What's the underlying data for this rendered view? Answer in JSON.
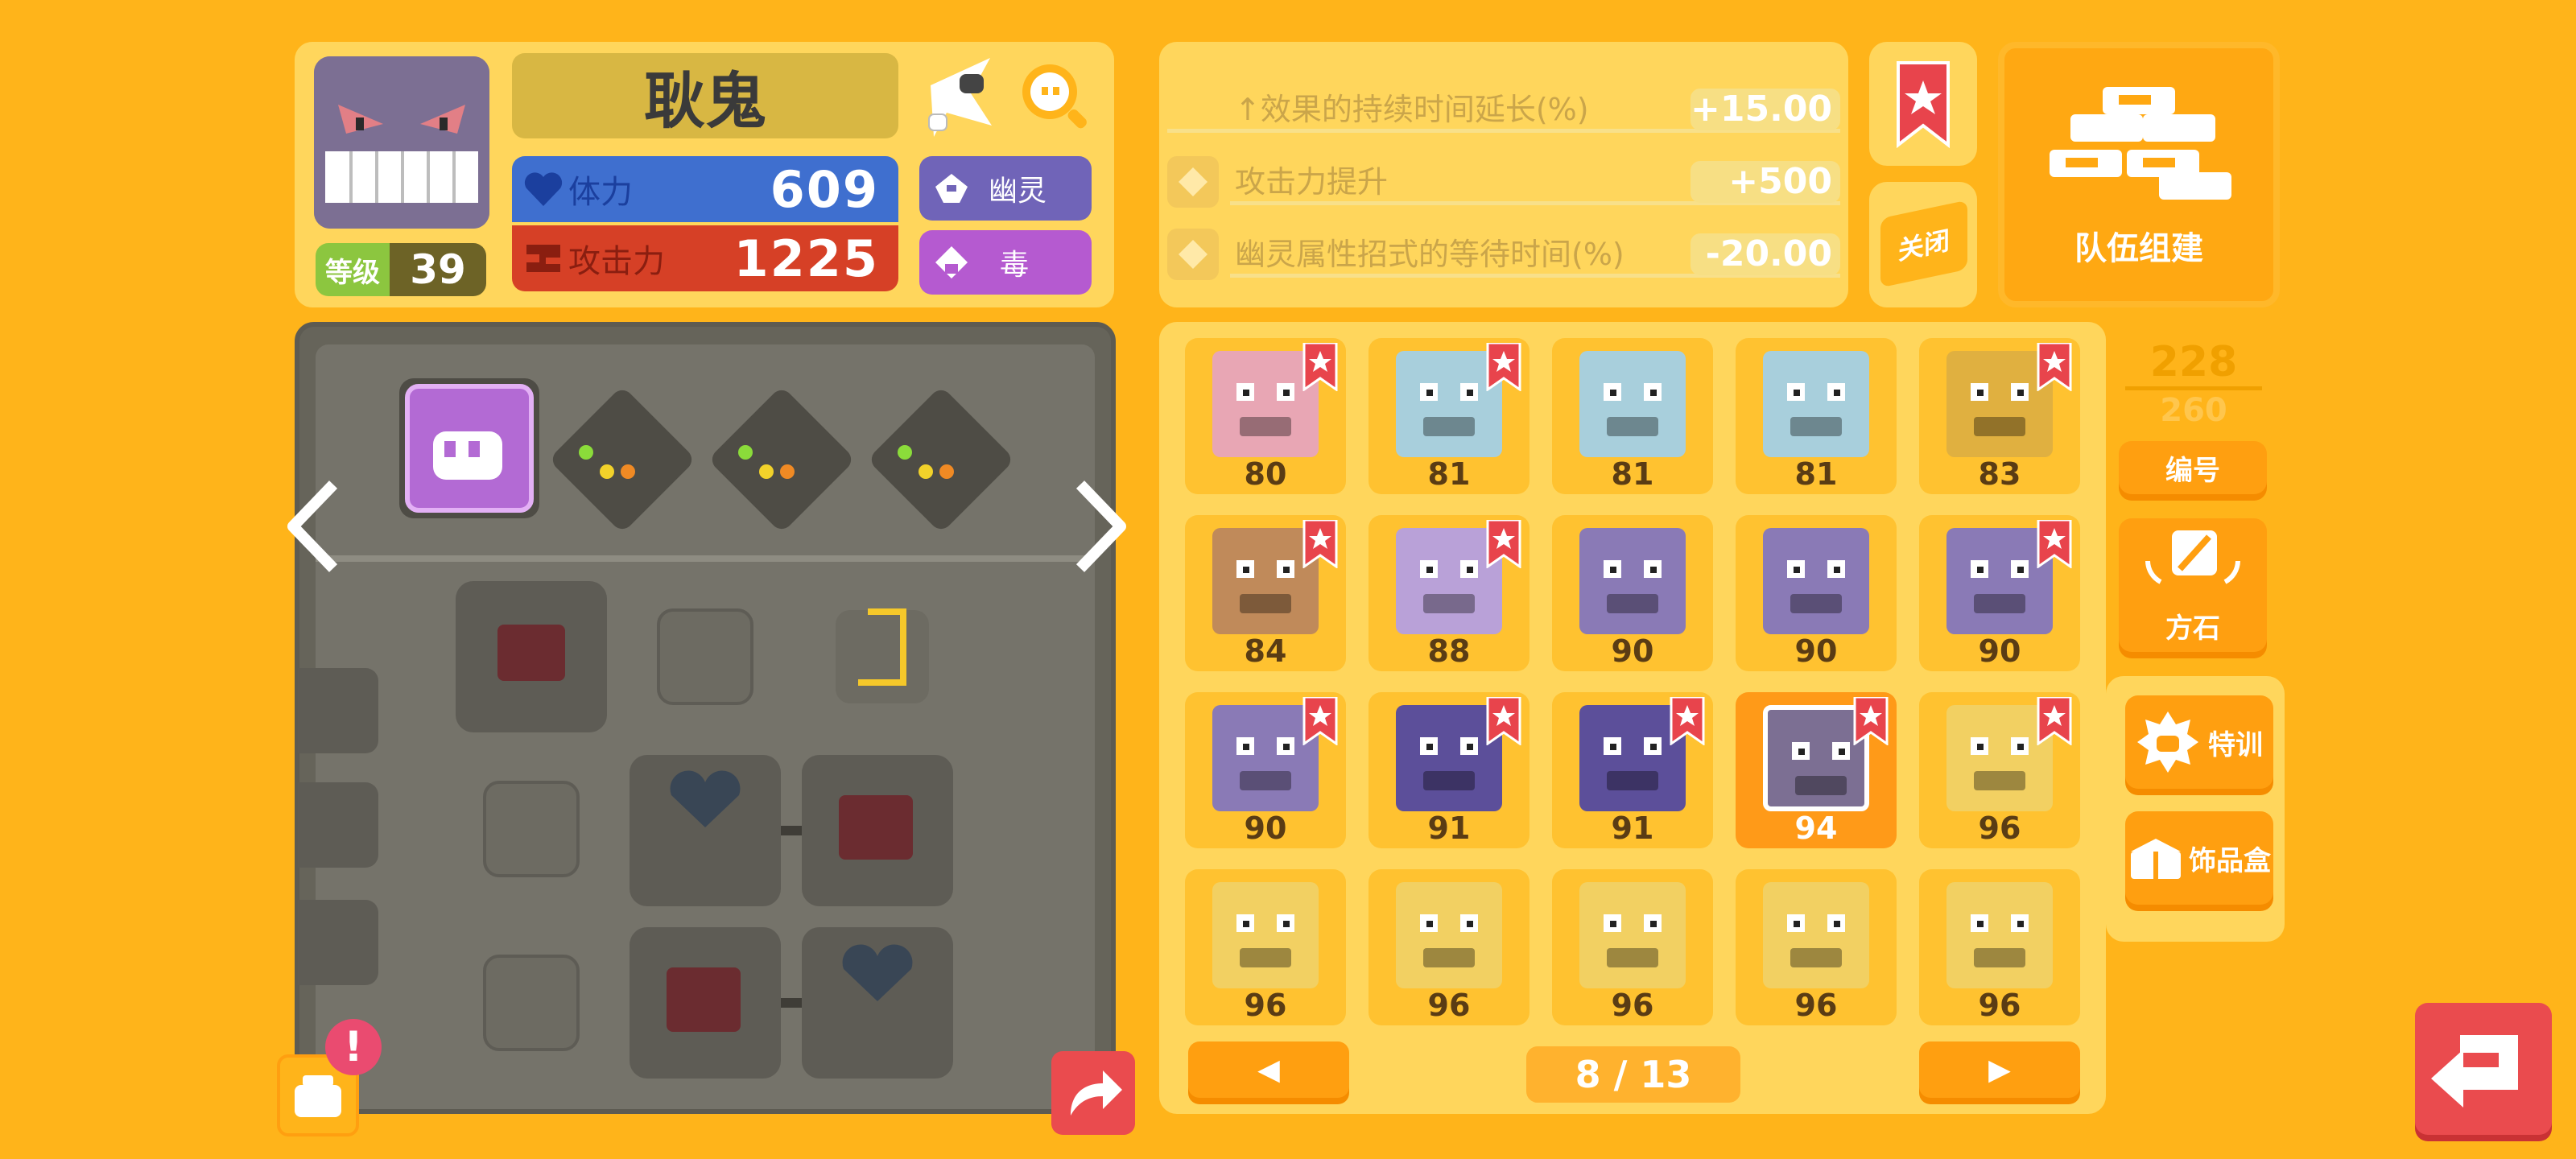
{
  "pokemon": {
    "name": "耿鬼",
    "level_label": "等级",
    "level": "39",
    "hp_label": "体力",
    "hp": "609",
    "attack_label": "攻击力",
    "attack": "1225",
    "types": [
      "幽灵",
      "毒"
    ]
  },
  "skills": [
    {
      "label": "↑效果的持续时间延长(%)",
      "value": "+15.00"
    },
    {
      "label": "攻击力提升",
      "value": "+500"
    },
    {
      "label": "幽灵属性招式的等待时间(%)",
      "value": "-20.00"
    }
  ],
  "close_label": "关闭",
  "team_label": "队伍组建",
  "box": {
    "count": "228",
    "capacity": "260",
    "number_label": "编号",
    "stones_label": "方石",
    "training_label": "特训",
    "accessory_label": "饰品盒",
    "page": "8 / 13",
    "prev_icon": "◀",
    "next_icon": "▶"
  },
  "grid": [
    {
      "level": "80",
      "color": "#e8a6b4",
      "bookmark": true
    },
    {
      "level": "81",
      "color": "#a8cfdc",
      "bookmark": true
    },
    {
      "level": "81",
      "color": "#a8cfdc",
      "bookmark": false
    },
    {
      "level": "81",
      "color": "#a8cfdc",
      "bookmark": false
    },
    {
      "level": "83",
      "color": "#e0b040",
      "bookmark": true
    },
    {
      "level": "84",
      "color": "#c08a5a",
      "bookmark": true
    },
    {
      "level": "88",
      "color": "#b9a1d8",
      "bookmark": true
    },
    {
      "level": "90",
      "color": "#8a7ab6",
      "bookmark": false
    },
    {
      "level": "90",
      "color": "#8a7ab6",
      "bookmark": false
    },
    {
      "level": "90",
      "color": "#8a7ab6",
      "bookmark": true
    },
    {
      "level": "90",
      "color": "#8a7ab6",
      "bookmark": true
    },
    {
      "level": "91",
      "color": "#5c4f9a",
      "bookmark": true
    },
    {
      "level": "91",
      "color": "#5c4f9a",
      "bookmark": true
    },
    {
      "level": "94",
      "color": "#7c6f93",
      "bookmark": true,
      "selected": true
    },
    {
      "level": "96",
      "color": "#f2d062",
      "bookmark": true
    },
    {
      "level": "96",
      "color": "#f2d062",
      "bookmark": false
    },
    {
      "level": "96",
      "color": "#f2d062",
      "bookmark": false
    },
    {
      "level": "96",
      "color": "#f2d062",
      "bookmark": false
    },
    {
      "level": "96",
      "color": "#f2d062",
      "bookmark": false
    },
    {
      "level": "96",
      "color": "#f2d062",
      "bookmark": false
    }
  ],
  "icons": [
    "heart-icon",
    "attack-icon",
    "ghost-type-icon",
    "poison-type-icon",
    "search-icon",
    "bookmark-star-icon",
    "team-icon",
    "back-icon",
    "share-icon",
    "cooking-pot-icon"
  ],
  "colors": {
    "background": "#ffb41a",
    "panel": "#ffd65c",
    "accent": "#ff9f10",
    "hp": "#3f6fcf",
    "attack": "#d64026",
    "ghost": "#7064b8",
    "poison": "#b55ad0"
  }
}
